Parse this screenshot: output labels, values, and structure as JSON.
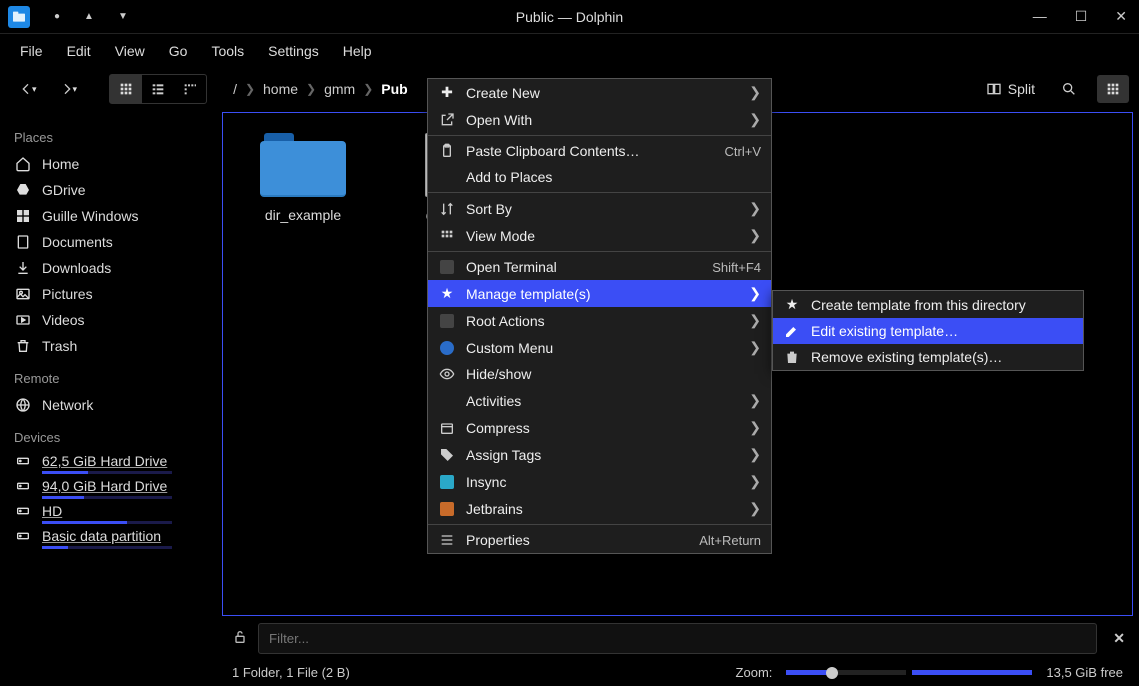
{
  "window": {
    "title": "Public — Dolphin"
  },
  "menubar": [
    "File",
    "Edit",
    "View",
    "Go",
    "Tools",
    "Settings",
    "Help"
  ],
  "toolbar": {
    "split": "Split"
  },
  "breadcrumb": [
    "/",
    "home",
    "gmm",
    "Pub"
  ],
  "sidebar": {
    "sections": {
      "places": {
        "header": "Places",
        "items": [
          "Home",
          "GDrive",
          "Guille Windows",
          "Documents",
          "Downloads",
          "Pictures",
          "Videos",
          "Trash"
        ]
      },
      "remote": {
        "header": "Remote",
        "items": [
          "Network"
        ]
      },
      "devices": {
        "header": "Devices",
        "items": [
          {
            "label": "62,5 GiB Hard Drive",
            "usage": 35
          },
          {
            "label": "94,0 GiB Hard Drive",
            "usage": 32
          },
          {
            "label": "HD",
            "usage": 65
          },
          {
            "label": "Basic data partition",
            "usage": 20
          }
        ]
      }
    }
  },
  "files": {
    "dir": "dir_example",
    "file": "ex"
  },
  "context_menu": {
    "create_new": "Create New",
    "open_with": "Open With",
    "paste": "Paste Clipboard Contents…",
    "paste_sc": "Ctrl+V",
    "add_places": "Add to Places",
    "sort_by": "Sort By",
    "view_mode": "View Mode",
    "open_terminal": "Open Terminal",
    "open_terminal_sc": "Shift+F4",
    "manage_templates": "Manage template(s)",
    "root_actions": "Root Actions",
    "custom_menu": "Custom Menu",
    "hide_show": "Hide/show",
    "activities": "Activities",
    "compress": "Compress",
    "assign_tags": "Assign Tags",
    "insync": "Insync",
    "jetbrains": "Jetbrains",
    "properties": "Properties",
    "properties_sc": "Alt+Return"
  },
  "submenu": {
    "create": "Create template from this directory",
    "edit": "Edit existing template…",
    "remove": "Remove existing template(s)…"
  },
  "filter": {
    "placeholder": "Filter..."
  },
  "status": {
    "left": "1 Folder, 1 File (2 B)",
    "zoom": "Zoom:",
    "free": "13,5 GiB free"
  }
}
